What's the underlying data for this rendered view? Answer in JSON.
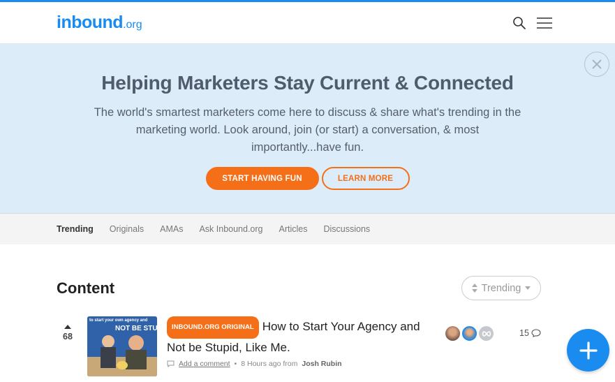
{
  "header": {
    "logo_main": "inbound",
    "logo_suffix": ".org"
  },
  "hero": {
    "title": "Helping Marketers Stay Current & Connected",
    "description": "The world's smartest marketers come here to discuss & share what's trending in the marketing world. Look around, join (or start) a conversation, & most importantly...have fun.",
    "primary_button": "START HAVING FUN",
    "secondary_button": "LEARN MORE"
  },
  "nav": {
    "tabs": [
      "Trending",
      "Originals",
      "AMAs",
      "Ask Inbound.org",
      "Articles",
      "Discussions"
    ]
  },
  "content": {
    "title": "Content",
    "sort_value": "Trending"
  },
  "posts": [
    {
      "votes": "68",
      "badge": "INBOUND.ORG ORIGINAL",
      "title": "How to Start Your Agency and Not be Stupid, Like Me.",
      "add_comment": "Add a comment",
      "separator": "•",
      "time": "8 Hours ago from",
      "author": "Josh Rubin",
      "comment_count": "15",
      "thumb_text_top": "to start your own agency and",
      "thumb_text_big": "NOT BE STUP"
    }
  ],
  "colors": {
    "brand_blue": "#1a8cf0",
    "accent_orange": "#f56e18",
    "hero_bg": "#dcecf8"
  }
}
